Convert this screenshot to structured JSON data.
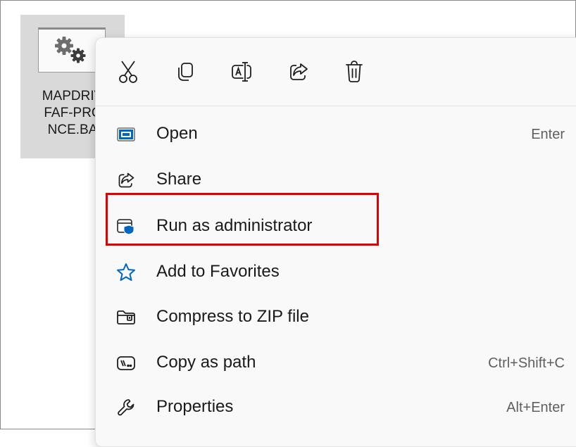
{
  "file": {
    "name_lines": [
      "MAPDRIV",
      "FAF-PRC",
      "NCE.BA"
    ],
    "icon": "gears-icon"
  },
  "menu": {
    "toolbar": [
      {
        "name": "cut",
        "icon": "scissors-icon"
      },
      {
        "name": "copy",
        "icon": "copy-icon"
      },
      {
        "name": "rename",
        "icon": "rename-icon"
      },
      {
        "name": "share",
        "icon": "share-icon"
      },
      {
        "name": "delete",
        "icon": "trash-icon"
      }
    ],
    "items": [
      {
        "label": "Open",
        "shortcut": "Enter",
        "icon": "open-window-icon"
      },
      {
        "label": "Share",
        "shortcut": "",
        "icon": "share-icon"
      },
      {
        "label": "Run as administrator",
        "shortcut": "",
        "icon": "shield-window-icon",
        "highlighted": true
      },
      {
        "label": "Add to Favorites",
        "shortcut": "",
        "icon": "star-icon"
      },
      {
        "label": "Compress to ZIP file",
        "shortcut": "",
        "icon": "zip-folder-icon"
      },
      {
        "label": "Copy as path",
        "shortcut": "Ctrl+Shift+C",
        "icon": "path-icon"
      },
      {
        "label": "Properties",
        "shortcut": "Alt+Enter",
        "icon": "wrench-icon"
      }
    ]
  },
  "colors": {
    "highlight_border": "#e00000",
    "accent_blue": "#0067c0",
    "menu_bg": "#f9f9f9",
    "tile_bg": "#d9d9d9"
  }
}
